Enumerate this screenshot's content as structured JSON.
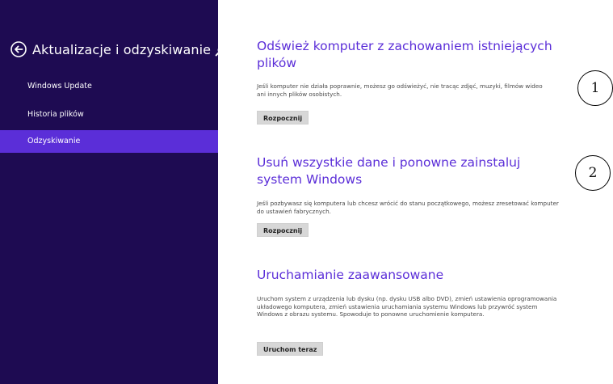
{
  "sidebar": {
    "title": "Aktualizacje i odzyskiwanie",
    "items": [
      {
        "label": "Windows Update"
      },
      {
        "label": "Historia plików"
      },
      {
        "label": "Odzyskiwanie"
      }
    ]
  },
  "sections": [
    {
      "title": "Odśwież komputer z zachowaniem istniejących plików",
      "description": "Jeśli komputer nie działa poprawnie, możesz go odświeżyć, nie tracąc zdjęć, muzyki, filmów wideo ani innych plików osobistych.",
      "button": "Rozpocznij"
    },
    {
      "title": "Usuń wszystkie dane i ponowne zainstaluj system Windows",
      "description": "Jeśli pozbywasz się komputera lub chcesz wrócić do stanu początkowego, możesz zresetować komputer do ustawień fabrycznych.",
      "button": "Rozpocznij"
    },
    {
      "title": "Uruchamianie zaawansowane",
      "description": "Uruchom system z urządzenia lub dysku (np. dysku USB albo DVD), zmień ustawienia oprogramowania układowego komputera, zmień ustawienia uruchamiania systemu Windows lub przywróć system Windows z obrazu systemu. Spowoduje to ponowne uruchomienie komputera.",
      "button": "Uruchom teraz"
    }
  ],
  "callouts": [
    "1",
    "2"
  ],
  "colors": {
    "sidebar_bg": "#1e0b52",
    "active_item": "#5b2ed8",
    "heading": "#5b2ed8"
  }
}
